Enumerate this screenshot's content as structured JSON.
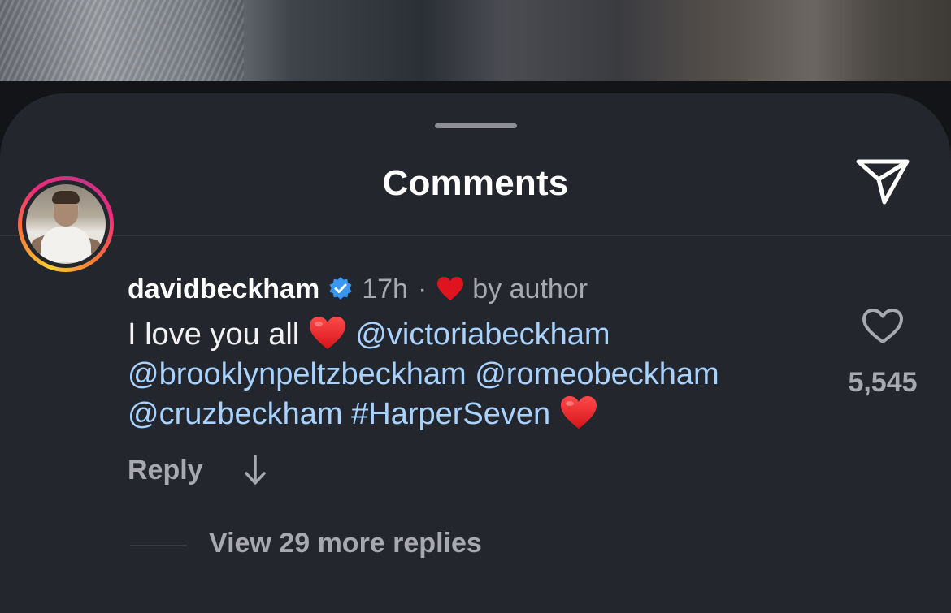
{
  "sheet": {
    "title": "Comments"
  },
  "comment": {
    "username": "davidbeckham",
    "time": "17h",
    "separator": "·",
    "liked_by_author_text": "by author",
    "text_intro": "I love you all",
    "mentions": [
      "@victoriabeckham",
      "@brooklynpeltzbeckham",
      "@romeobeckham",
      "@cruzbeckham"
    ],
    "hashtag": "#HarperSeven",
    "like_count": "5,545",
    "reply_label": "Reply",
    "view_replies_label": "View 29 more replies"
  },
  "colors": {
    "sheet_bg": "#24262d",
    "mention": "#a8d2ff",
    "verified": "#3897f0",
    "heart": "#e0141e"
  },
  "icons": {
    "share": "paper-plane-icon",
    "verified": "verified-badge-icon",
    "author_like": "red-heart-icon",
    "like": "heart-outline-icon",
    "expand": "arrow-down-icon"
  }
}
